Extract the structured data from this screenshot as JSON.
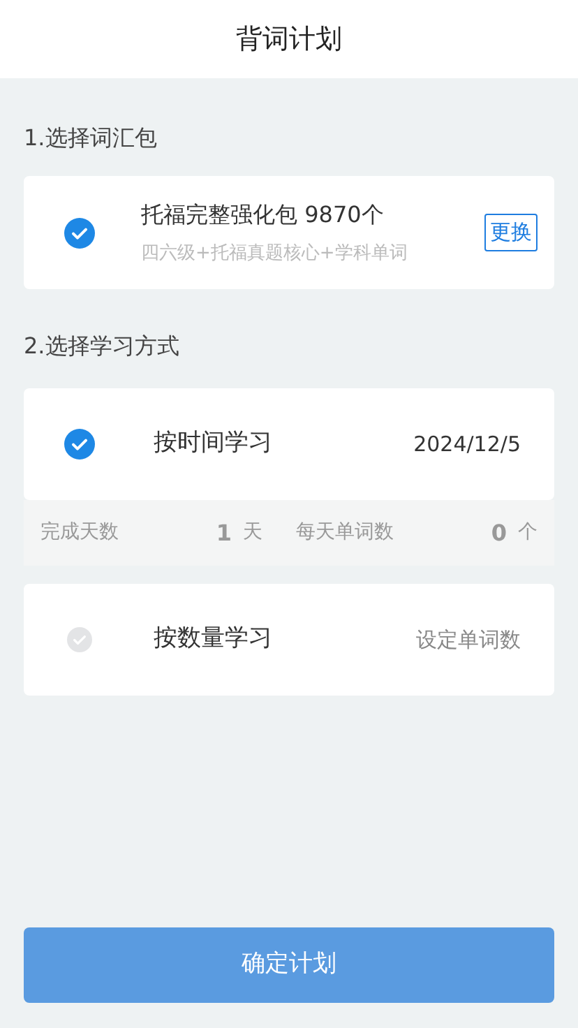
{
  "header": {
    "title": "背词计划"
  },
  "vocab_section": {
    "label": "1.选择词汇包",
    "package": {
      "selected": true,
      "name": "托福完整强化包 9870个",
      "description": "四六级+托福真题核心+学科单词",
      "change_button": "更换"
    }
  },
  "method_section": {
    "label": "2.选择学习方式",
    "methods": [
      {
        "kind": "date",
        "selected": true,
        "title": "按时间学习",
        "value": "2024/12/5",
        "stats": [
          {
            "label": "完成天数",
            "number": "1",
            "unit": "天"
          },
          {
            "label": "每天单词数",
            "number": "0",
            "unit": "个"
          }
        ]
      },
      {
        "kind": "count",
        "selected": false,
        "title": "按数量学习",
        "value": "设定单词数"
      }
    ]
  },
  "confirm_button": "确定计划"
}
